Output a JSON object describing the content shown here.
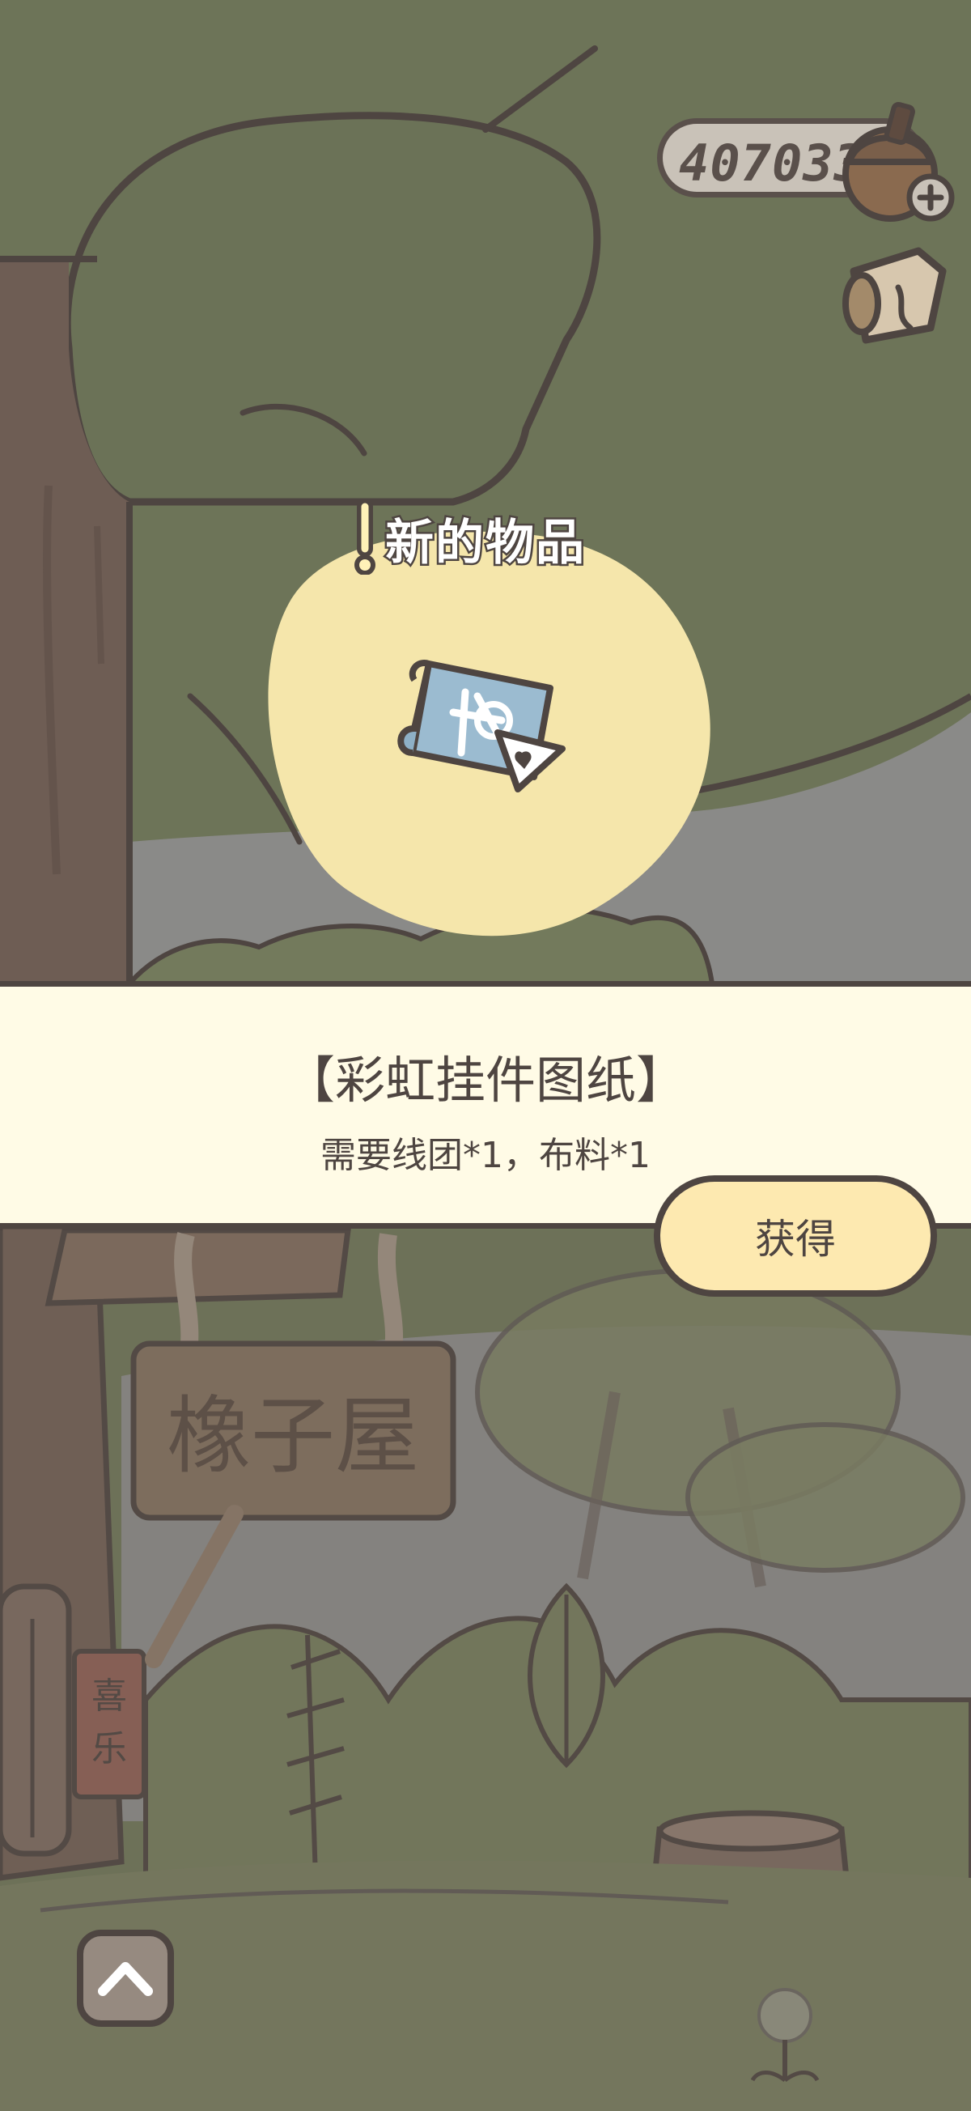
{
  "currency": {
    "acorn_count": "407033",
    "icon": "acorn-plus-icon"
  },
  "map_button": {
    "icon": "map-scroll-icon"
  },
  "new_item": {
    "header": "新的物品",
    "header_icon": "exclamation-icon",
    "item_icon": "blueprint-scroll-icon",
    "name": "【彩虹挂件图纸】",
    "requirements": "需要线团*1，布料*1"
  },
  "actions": {
    "obtain_label": "获得",
    "expand_icon": "chevron-up-icon"
  },
  "scene": {
    "sign_text": "橡子屋",
    "tag_text": "喜乐"
  },
  "colors": {
    "outline": "#4e4541",
    "banner_bg": "#fffbe6",
    "button_bg": "#fde9b0",
    "blob": "#f5e6ab",
    "foliage": "#6d7458"
  }
}
